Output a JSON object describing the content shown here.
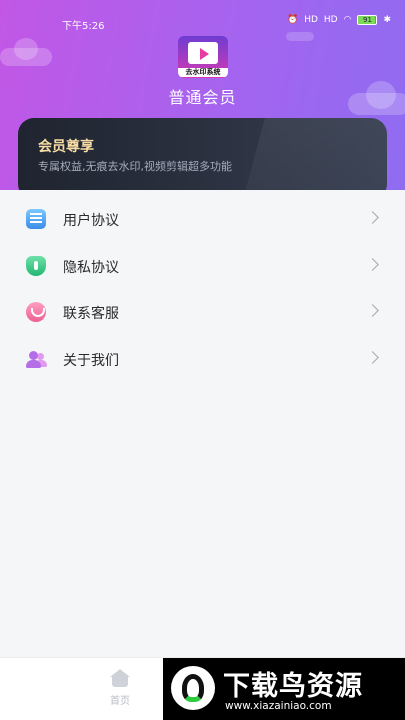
{
  "status_bar": {
    "time": "下午5:26",
    "signal_1": "HD",
    "signal_2": "HD",
    "wifi": "wifi",
    "battery": "91",
    "bluetooth": "✱"
  },
  "header": {
    "app_logo_caption": "去水印系统",
    "member_level": "普通会员"
  },
  "vip_card": {
    "title": "会员尊享",
    "description": "专属权益,无痕去水印,视频剪辑超多功能"
  },
  "menu": {
    "items": [
      {
        "label": "用户协议",
        "icon": "document-icon"
      },
      {
        "label": "隐私协议",
        "icon": "shield-icon"
      },
      {
        "label": "联系客服",
        "icon": "phone-icon"
      },
      {
        "label": "关于我们",
        "icon": "people-icon"
      }
    ]
  },
  "tabbar": {
    "home_label": "首页"
  },
  "watermark": {
    "title": "下载鸟资源",
    "url": "www.xiazainiao.com"
  },
  "colors": {
    "header_gradient_start": "#c257e6",
    "header_gradient_end": "#8f6cf1",
    "vip_card_bg": "#262b37",
    "vip_title": "#f7dca4"
  }
}
